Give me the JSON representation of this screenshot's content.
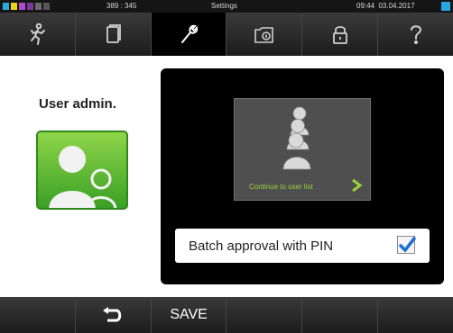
{
  "status_bar": {
    "coords": "389 : 345",
    "title": "Settings",
    "time": "09:44",
    "date": "03.04.2017",
    "indicator_colors": [
      "#2aa8e0",
      "#e8d21c",
      "#b24acb",
      "#7a3a9a",
      "#6a6a6a",
      "#555555"
    ]
  },
  "nav": {
    "tabs": [
      {
        "icon": "running-man-icon"
      },
      {
        "icon": "documents-icon"
      },
      {
        "icon": "wrench-icon",
        "active": true
      },
      {
        "icon": "device-info-icon"
      },
      {
        "icon": "padlock-icon"
      },
      {
        "icon": "help-icon"
      }
    ]
  },
  "main": {
    "user_admin_label": "User admin.",
    "user_list_label": "Continue to user list",
    "batch_approval_label": "Batch approval with PIN",
    "batch_approval_checked": true
  },
  "bottom": {
    "save_label": "SAVE"
  },
  "colors": {
    "accent_green": "#3aa025",
    "link_green": "#9bd23a",
    "check_blue": "#1e6fd0"
  }
}
